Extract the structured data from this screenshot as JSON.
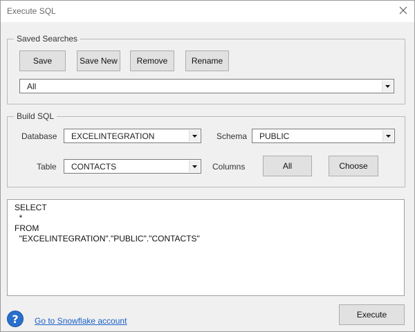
{
  "window": {
    "title": "Execute SQL"
  },
  "saved_searches": {
    "legend": "Saved Searches",
    "buttons": {
      "save": "Save",
      "save_new": "Save New",
      "remove": "Remove",
      "rename": "Rename"
    },
    "selected": "All"
  },
  "build_sql": {
    "legend": "Build SQL",
    "database_label": "Database",
    "database_value": "EXCELINTEGRATION",
    "schema_label": "Schema",
    "schema_value": "PUBLIC",
    "table_label": "Table",
    "table_value": "CONTACTS",
    "columns_label": "Columns",
    "all_button": "All",
    "choose_button": "Choose"
  },
  "sql_lines": [
    "SELECT",
    "  *",
    "FROM",
    "  \"EXCELINTEGRATION\".\"PUBLIC\".\"CONTACTS\""
  ],
  "footer": {
    "link": "Go to Snowflake account",
    "execute_button": "Execute"
  }
}
